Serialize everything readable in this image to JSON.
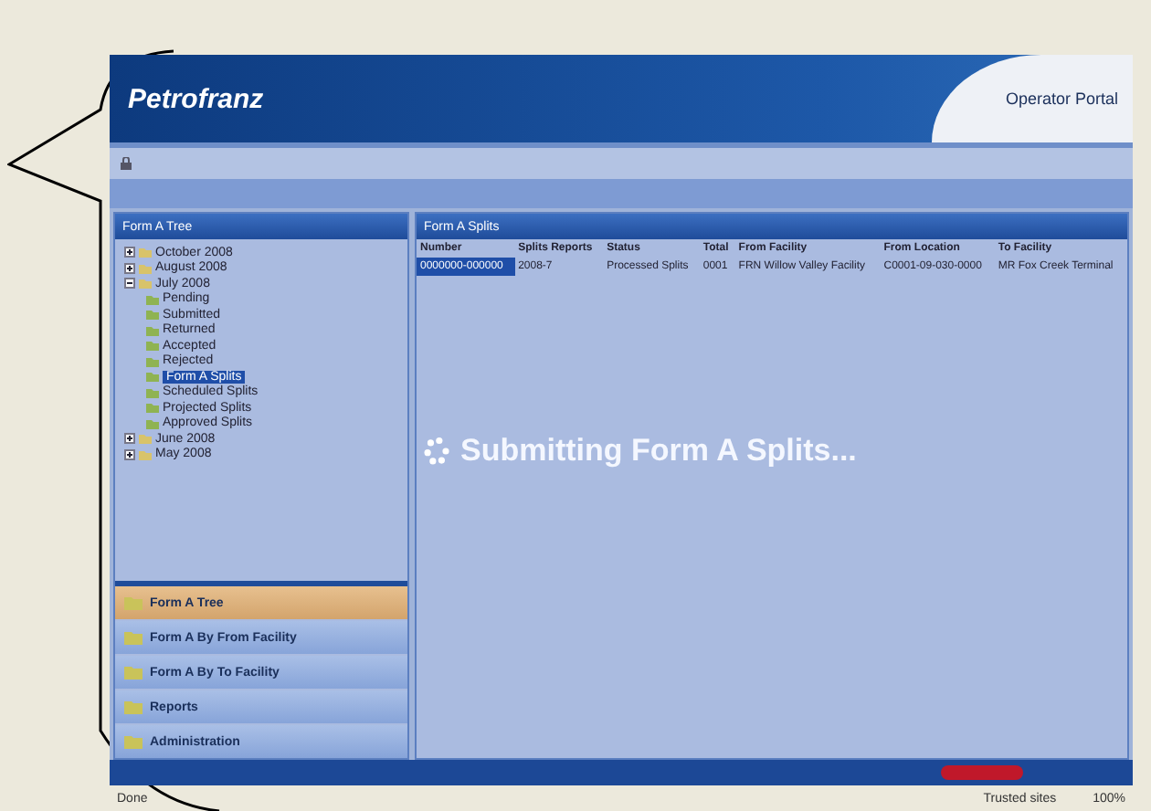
{
  "header": {
    "logo": "Petrofranz",
    "portal": "Operator Portal"
  },
  "tree": {
    "title": "Form A Tree",
    "items": [
      {
        "label": "October 2008",
        "expanded": false
      },
      {
        "label": "August 2008",
        "expanded": false
      },
      {
        "label": "July 2008",
        "expanded": true,
        "children": [
          {
            "label": "Pending",
            "selected": false
          },
          {
            "label": "Submitted",
            "selected": false
          },
          {
            "label": "Returned",
            "selected": false
          },
          {
            "label": "Accepted",
            "selected": false
          },
          {
            "label": "Rejected",
            "selected": false
          },
          {
            "label": "Form A Splits",
            "selected": true
          },
          {
            "label": "Scheduled Splits",
            "selected": false
          },
          {
            "label": "Projected Splits",
            "selected": false
          },
          {
            "label": "Approved Splits",
            "selected": false
          }
        ]
      },
      {
        "label": "June 2008",
        "expanded": false
      },
      {
        "label": "May 2008",
        "expanded": false
      }
    ]
  },
  "nav": [
    {
      "label": "Form A Tree",
      "selected": true
    },
    {
      "label": "Form A By From Facility",
      "selected": false
    },
    {
      "label": "Form A By To Facility",
      "selected": false
    },
    {
      "label": "Reports",
      "selected": false
    },
    {
      "label": "Administration",
      "selected": false
    }
  ],
  "table": {
    "title": "Form A Splits",
    "columns": [
      "Number",
      "Splits Reports",
      "Status",
      "Total",
      "From Facility",
      "From Location",
      "To Facility"
    ],
    "rows": [
      {
        "selected": true,
        "cells": [
          "0000000-000000",
          "2008-7",
          "Processed Splits",
          "0001",
          "FRN Willow Valley Facility",
          "C0001-09-030-0000",
          "MR Fox Creek Terminal"
        ]
      }
    ]
  },
  "loading": "Submitting Form A Splits...",
  "browser_status": {
    "left": "Done",
    "zone": "Trusted sites",
    "zoom": "100%"
  }
}
